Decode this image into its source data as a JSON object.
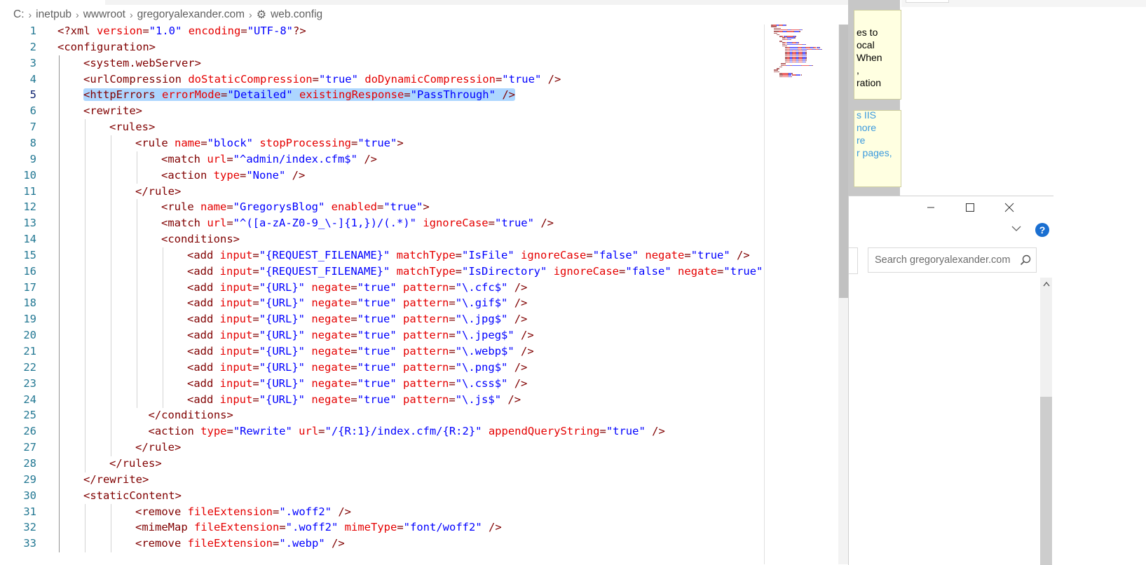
{
  "breadcrumb": {
    "items": [
      "C:",
      "inetpub",
      "wwwroot",
      "gregoryalexander.com",
      "web.config"
    ],
    "file_icon": "gear-icon"
  },
  "code_lines": [
    {
      "n": "1",
      "indent": 0,
      "toks": [
        [
          "p",
          "<?xml "
        ],
        [
          "a",
          "version"
        ],
        [
          "p",
          "="
        ],
        [
          "v",
          "\"1.0\""
        ],
        [
          "p",
          " "
        ],
        [
          "a",
          "encoding"
        ],
        [
          "p",
          "="
        ],
        [
          "v",
          "\"UTF-8\""
        ],
        [
          "p",
          "?>"
        ]
      ]
    },
    {
      "n": "2",
      "indent": 0,
      "toks": [
        [
          "p",
          "<configuration>"
        ]
      ]
    },
    {
      "n": "3",
      "indent": 1,
      "toks": [
        [
          "p",
          "<system.webServer>"
        ]
      ]
    },
    {
      "n": "4",
      "indent": 1,
      "toks": [
        [
          "p",
          "<urlCompression "
        ],
        [
          "a",
          "doStaticCompression"
        ],
        [
          "p",
          "="
        ],
        [
          "v",
          "\"true\""
        ],
        [
          "p",
          " "
        ],
        [
          "a",
          "doDynamicCompression"
        ],
        [
          "p",
          "="
        ],
        [
          "v",
          "\"true\""
        ],
        [
          "p",
          " />"
        ]
      ]
    },
    {
      "n": "5",
      "indent": 1,
      "selected": true,
      "toks": [
        [
          "p",
          "<httpErrors "
        ],
        [
          "a",
          "errorMode"
        ],
        [
          "p",
          "="
        ],
        [
          "v",
          "\"Detailed\""
        ],
        [
          "p",
          " "
        ],
        [
          "a",
          "existingResponse"
        ],
        [
          "p",
          "="
        ],
        [
          "v",
          "\"PassThrough\""
        ],
        [
          "p",
          " />"
        ]
      ]
    },
    {
      "n": "6",
      "indent": 1,
      "toks": [
        [
          "p",
          "<rewrite>"
        ]
      ]
    },
    {
      "n": "7",
      "indent": 2,
      "toks": [
        [
          "p",
          "<rules>"
        ]
      ]
    },
    {
      "n": "8",
      "indent": 3,
      "toks": [
        [
          "p",
          "<rule "
        ],
        [
          "a",
          "name"
        ],
        [
          "p",
          "="
        ],
        [
          "v",
          "\"block\""
        ],
        [
          "p",
          " "
        ],
        [
          "a",
          "stopProcessing"
        ],
        [
          "p",
          "="
        ],
        [
          "v",
          "\"true\""
        ],
        [
          "p",
          ">"
        ]
      ]
    },
    {
      "n": "9",
      "indent": 4,
      "toks": [
        [
          "p",
          "<match "
        ],
        [
          "a",
          "url"
        ],
        [
          "p",
          "="
        ],
        [
          "v",
          "\"^admin/index.cfm$\""
        ],
        [
          "p",
          " />"
        ]
      ]
    },
    {
      "n": "10",
      "indent": 4,
      "toks": [
        [
          "p",
          "<action "
        ],
        [
          "a",
          "type"
        ],
        [
          "p",
          "="
        ],
        [
          "v",
          "\"None\""
        ],
        [
          "p",
          " />"
        ]
      ]
    },
    {
      "n": "11",
      "indent": 3,
      "toks": [
        [
          "p",
          "</rule>"
        ]
      ]
    },
    {
      "n": "12",
      "indent": 4,
      "toks": [
        [
          "p",
          "<rule "
        ],
        [
          "a",
          "name"
        ],
        [
          "p",
          "="
        ],
        [
          "v",
          "\"GregorysBlog\""
        ],
        [
          "p",
          " "
        ],
        [
          "a",
          "enabled"
        ],
        [
          "p",
          "="
        ],
        [
          "v",
          "\"true\""
        ],
        [
          "p",
          ">"
        ]
      ]
    },
    {
      "n": "13",
      "indent": 4,
      "toks": [
        [
          "p",
          "<match "
        ],
        [
          "a",
          "url"
        ],
        [
          "p",
          "="
        ],
        [
          "v",
          "\"^([a-zA-Z0-9_\\-]{1,})/(.*)\""
        ],
        [
          "p",
          " "
        ],
        [
          "a",
          "ignoreCase"
        ],
        [
          "p",
          "="
        ],
        [
          "v",
          "\"true\""
        ],
        [
          "p",
          " />"
        ]
      ]
    },
    {
      "n": "14",
      "indent": 4,
      "toks": [
        [
          "p",
          "<conditions>"
        ]
      ]
    },
    {
      "n": "15",
      "indent": 5,
      "toks": [
        [
          "p",
          "<add "
        ],
        [
          "a",
          "input"
        ],
        [
          "p",
          "="
        ],
        [
          "v",
          "\"{REQUEST_FILENAME}\""
        ],
        [
          "p",
          " "
        ],
        [
          "a",
          "matchType"
        ],
        [
          "p",
          "="
        ],
        [
          "v",
          "\"IsFile\""
        ],
        [
          "p",
          " "
        ],
        [
          "a",
          "ignoreCase"
        ],
        [
          "p",
          "="
        ],
        [
          "v",
          "\"false\""
        ],
        [
          "p",
          " "
        ],
        [
          "a",
          "negate"
        ],
        [
          "p",
          "="
        ],
        [
          "v",
          "\"true\""
        ],
        [
          "p",
          " />"
        ]
      ]
    },
    {
      "n": "16",
      "indent": 5,
      "toks": [
        [
          "p",
          "<add "
        ],
        [
          "a",
          "input"
        ],
        [
          "p",
          "="
        ],
        [
          "v",
          "\"{REQUEST_FILENAME}\""
        ],
        [
          "p",
          " "
        ],
        [
          "a",
          "matchType"
        ],
        [
          "p",
          "="
        ],
        [
          "v",
          "\"IsDirectory\""
        ],
        [
          "p",
          " "
        ],
        [
          "a",
          "ignoreCase"
        ],
        [
          "p",
          "="
        ],
        [
          "v",
          "\"false\""
        ],
        [
          "p",
          " "
        ],
        [
          "a",
          "negate"
        ],
        [
          "p",
          "="
        ],
        [
          "v",
          "\"true\""
        ],
        [
          "p",
          " />"
        ]
      ]
    },
    {
      "n": "17",
      "indent": 5,
      "toks": [
        [
          "p",
          "<add "
        ],
        [
          "a",
          "input"
        ],
        [
          "p",
          "="
        ],
        [
          "v",
          "\"{URL}\""
        ],
        [
          "p",
          " "
        ],
        [
          "a",
          "negate"
        ],
        [
          "p",
          "="
        ],
        [
          "v",
          "\"true\""
        ],
        [
          "p",
          " "
        ],
        [
          "a",
          "pattern"
        ],
        [
          "p",
          "="
        ],
        [
          "v",
          "\"\\.cfc$\""
        ],
        [
          "p",
          " />"
        ]
      ]
    },
    {
      "n": "18",
      "indent": 5,
      "toks": [
        [
          "p",
          "<add "
        ],
        [
          "a",
          "input"
        ],
        [
          "p",
          "="
        ],
        [
          "v",
          "\"{URL}\""
        ],
        [
          "p",
          " "
        ],
        [
          "a",
          "negate"
        ],
        [
          "p",
          "="
        ],
        [
          "v",
          "\"true\""
        ],
        [
          "p",
          " "
        ],
        [
          "a",
          "pattern"
        ],
        [
          "p",
          "="
        ],
        [
          "v",
          "\"\\.gif$\""
        ],
        [
          "p",
          " />"
        ]
      ]
    },
    {
      "n": "19",
      "indent": 5,
      "toks": [
        [
          "p",
          "<add "
        ],
        [
          "a",
          "input"
        ],
        [
          "p",
          "="
        ],
        [
          "v",
          "\"{URL}\""
        ],
        [
          "p",
          " "
        ],
        [
          "a",
          "negate"
        ],
        [
          "p",
          "="
        ],
        [
          "v",
          "\"true\""
        ],
        [
          "p",
          " "
        ],
        [
          "a",
          "pattern"
        ],
        [
          "p",
          "="
        ],
        [
          "v",
          "\"\\.jpg$\""
        ],
        [
          "p",
          " />"
        ]
      ]
    },
    {
      "n": "20",
      "indent": 5,
      "toks": [
        [
          "p",
          "<add "
        ],
        [
          "a",
          "input"
        ],
        [
          "p",
          "="
        ],
        [
          "v",
          "\"{URL}\""
        ],
        [
          "p",
          " "
        ],
        [
          "a",
          "negate"
        ],
        [
          "p",
          "="
        ],
        [
          "v",
          "\"true\""
        ],
        [
          "p",
          " "
        ],
        [
          "a",
          "pattern"
        ],
        [
          "p",
          "="
        ],
        [
          "v",
          "\"\\.jpeg$\""
        ],
        [
          "p",
          " />"
        ]
      ]
    },
    {
      "n": "21",
      "indent": 5,
      "toks": [
        [
          "p",
          "<add "
        ],
        [
          "a",
          "input"
        ],
        [
          "p",
          "="
        ],
        [
          "v",
          "\"{URL}\""
        ],
        [
          "p",
          " "
        ],
        [
          "a",
          "negate"
        ],
        [
          "p",
          "="
        ],
        [
          "v",
          "\"true\""
        ],
        [
          "p",
          " "
        ],
        [
          "a",
          "pattern"
        ],
        [
          "p",
          "="
        ],
        [
          "v",
          "\"\\.webp$\""
        ],
        [
          "p",
          " />"
        ]
      ]
    },
    {
      "n": "22",
      "indent": 5,
      "toks": [
        [
          "p",
          "<add "
        ],
        [
          "a",
          "input"
        ],
        [
          "p",
          "="
        ],
        [
          "v",
          "\"{URL}\""
        ],
        [
          "p",
          " "
        ],
        [
          "a",
          "negate"
        ],
        [
          "p",
          "="
        ],
        [
          "v",
          "\"true\""
        ],
        [
          "p",
          " "
        ],
        [
          "a",
          "pattern"
        ],
        [
          "p",
          "="
        ],
        [
          "v",
          "\"\\.png$\""
        ],
        [
          "p",
          " />"
        ]
      ]
    },
    {
      "n": "23",
      "indent": 5,
      "toks": [
        [
          "p",
          "<add "
        ],
        [
          "a",
          "input"
        ],
        [
          "p",
          "="
        ],
        [
          "v",
          "\"{URL}\""
        ],
        [
          "p",
          " "
        ],
        [
          "a",
          "negate"
        ],
        [
          "p",
          "="
        ],
        [
          "v",
          "\"true\""
        ],
        [
          "p",
          " "
        ],
        [
          "a",
          "pattern"
        ],
        [
          "p",
          "="
        ],
        [
          "v",
          "\"\\.css$\""
        ],
        [
          "p",
          " />"
        ]
      ]
    },
    {
      "n": "24",
      "indent": 5,
      "toks": [
        [
          "p",
          "<add "
        ],
        [
          "a",
          "input"
        ],
        [
          "p",
          "="
        ],
        [
          "v",
          "\"{URL}\""
        ],
        [
          "p",
          " "
        ],
        [
          "a",
          "negate"
        ],
        [
          "p",
          "="
        ],
        [
          "v",
          "\"true\""
        ],
        [
          "p",
          " "
        ],
        [
          "a",
          "pattern"
        ],
        [
          "p",
          "="
        ],
        [
          "v",
          "\"\\.js$\""
        ],
        [
          "p",
          " />"
        ]
      ]
    },
    {
      "n": "25",
      "indent": 3.5,
      "toks": [
        [
          "p",
          "</conditions>"
        ]
      ]
    },
    {
      "n": "26",
      "indent": 3.5,
      "toks": [
        [
          "p",
          "<action "
        ],
        [
          "a",
          "type"
        ],
        [
          "p",
          "="
        ],
        [
          "v",
          "\"Rewrite\""
        ],
        [
          "p",
          " "
        ],
        [
          "a",
          "url"
        ],
        [
          "p",
          "="
        ],
        [
          "v",
          "\"/{R:1}/index.cfm/{R:2}\""
        ],
        [
          "p",
          " "
        ],
        [
          "a",
          "appendQueryString"
        ],
        [
          "p",
          "="
        ],
        [
          "v",
          "\"true\""
        ],
        [
          "p",
          " />"
        ]
      ]
    },
    {
      "n": "27",
      "indent": 3,
      "toks": [
        [
          "p",
          "</rule>"
        ]
      ]
    },
    {
      "n": "28",
      "indent": 2,
      "toks": [
        [
          "p",
          "</rules>"
        ]
      ]
    },
    {
      "n": "29",
      "indent": 1,
      "toks": [
        [
          "p",
          "</rewrite>"
        ]
      ]
    },
    {
      "n": "30",
      "indent": 1,
      "toks": [
        [
          "p",
          "<staticContent>"
        ]
      ]
    },
    {
      "n": "31",
      "indent": 3,
      "toks": [
        [
          "p",
          "<remove "
        ],
        [
          "a",
          "fileExtension"
        ],
        [
          "p",
          "="
        ],
        [
          "v",
          "\".woff2\""
        ],
        [
          "p",
          " />"
        ]
      ]
    },
    {
      "n": "32",
      "indent": 3,
      "toks": [
        [
          "p",
          "<mimeMap "
        ],
        [
          "a",
          "fileExtension"
        ],
        [
          "p",
          "="
        ],
        [
          "v",
          "\".woff2\""
        ],
        [
          "p",
          " "
        ],
        [
          "a",
          "mimeType"
        ],
        [
          "p",
          "="
        ],
        [
          "v",
          "\"font/woff2\""
        ],
        [
          "p",
          " />"
        ]
      ]
    },
    {
      "n": "33",
      "indent": 3,
      "toks": [
        [
          "p",
          "<remove "
        ],
        [
          "a",
          "fileExtension"
        ],
        [
          "p",
          "="
        ],
        [
          "v",
          "\".webp\""
        ],
        [
          "p",
          " />"
        ]
      ]
    }
  ],
  "syntax_colors": {
    "tag": "#800000",
    "attribute": "#e50000",
    "value": "#0000ff",
    "line_number": "#237893",
    "selection": "#add6ff"
  },
  "tooltip_fragments": {
    "box1": [
      "es to",
      "ocal",
      "When",
      ",",
      "ration"
    ],
    "box2": [
      "s IIS",
      "nore",
      "re",
      "r pages,"
    ]
  },
  "explorer": {
    "search_placeholder": "Search gregoryalexander.com",
    "help_label": "?"
  }
}
